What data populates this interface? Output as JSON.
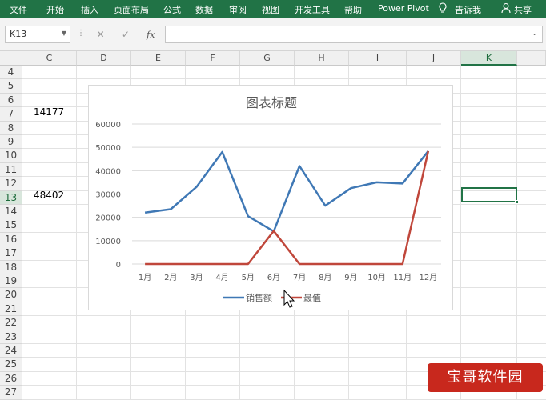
{
  "ribbon": {
    "tabs": [
      "文件",
      "开始",
      "插入",
      "页面布局",
      "公式",
      "数据",
      "审阅",
      "视图",
      "开发工具",
      "帮助",
      "Power Pivot"
    ],
    "tell_me": "告诉我",
    "share": "共享"
  },
  "formula_bar": {
    "name_box": "K13",
    "formula": ""
  },
  "columns": [
    "C",
    "D",
    "E",
    "F",
    "G",
    "H",
    "I",
    "J",
    "K"
  ],
  "selected_column": "K",
  "rows": [
    "4",
    "5",
    "6",
    "7",
    "8",
    "9",
    "10",
    "11",
    "12",
    "13",
    "14",
    "15",
    "16",
    "17",
    "18",
    "19",
    "20",
    "21",
    "22",
    "23",
    "24",
    "25",
    "26",
    "27"
  ],
  "selected_row": "13",
  "cells": {
    "C7": "14177",
    "C13": "48402"
  },
  "chart_data": {
    "type": "line",
    "title": "图表标题",
    "categories": [
      "1月",
      "2月",
      "3月",
      "4月",
      "5月",
      "6月",
      "7月",
      "8月",
      "9月",
      "10月",
      "11月",
      "12月"
    ],
    "series": [
      {
        "name": "销售额",
        "color": "#3f78b5",
        "values": [
          22000,
          23500,
          33000,
          48000,
          20500,
          14000,
          42000,
          25000,
          32500,
          35000,
          34500,
          48400
        ]
      },
      {
        "name": "最值",
        "color": "#c0473b",
        "values": [
          0,
          0,
          0,
          0,
          0,
          14177,
          0,
          0,
          0,
          0,
          0,
          48402
        ]
      }
    ],
    "ylim": [
      0,
      60000
    ],
    "yticks": [
      "0",
      "10000",
      "20000",
      "30000",
      "40000",
      "50000",
      "60000"
    ],
    "grid": true,
    "legend": "bottom"
  },
  "watermark": "宝哥软件园"
}
